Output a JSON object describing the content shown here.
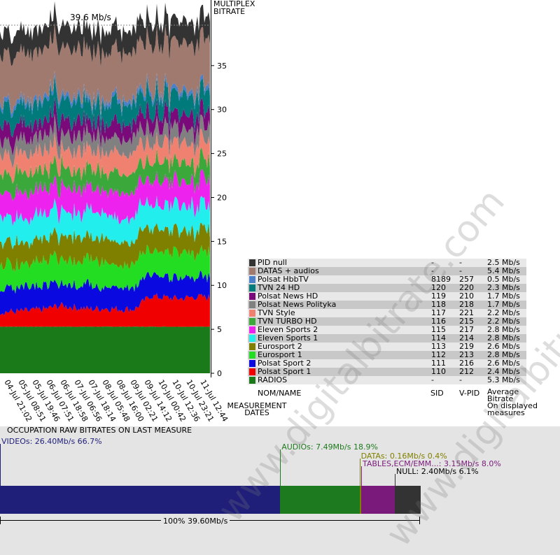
{
  "header": {
    "max_bitrate": "39.6 Mb/s"
  },
  "axis": {
    "title_line1": "MULTIPLEX",
    "title_line2": "BITRATE",
    "measurement_line1": "MEASUREMENT",
    "measurement_line2": "DATES"
  },
  "watermark": "www.digitalbitrate.com",
  "legend_headers": {
    "name": "NOM/NAME",
    "sid": "SID",
    "vpid": "V-PID",
    "avg1": "Average",
    "avg2": "Bitrate",
    "avg3": "On displayed",
    "avg4": "measures"
  },
  "legend": [
    {
      "name": "PID null",
      "sid": "-",
      "vpid": "-",
      "bitrate": "2.5 Mb/s",
      "color": "#333333"
    },
    {
      "name": "DATAS + audios",
      "sid": "-",
      "vpid": "-",
      "bitrate": "5.4 Mb/s",
      "color": "#a07a6e"
    },
    {
      "name": "Polsat  HbbTV",
      "sid": "8189",
      "vpid": "257",
      "bitrate": "0.5 Mb/s",
      "color": "#4a7fc9"
    },
    {
      "name": "TVN 24 HD",
      "sid": "120",
      "vpid": "220",
      "bitrate": "2.3 Mb/s",
      "color": "#007a7a"
    },
    {
      "name": "Polsat News HD",
      "sid": "119",
      "vpid": "210",
      "bitrate": "1.7 Mb/s",
      "color": "#7a0a7a"
    },
    {
      "name": "Polsat News Polityka",
      "sid": "118",
      "vpid": "218",
      "bitrate": "1.7 Mb/s",
      "color": "#808080"
    },
    {
      "name": "TVN Style",
      "sid": "117",
      "vpid": "221",
      "bitrate": "2.2 Mb/s",
      "color": "#f08070"
    },
    {
      "name": "TVN TURBO HD",
      "sid": "116",
      "vpid": "215",
      "bitrate": "2.2 Mb/s",
      "color": "#3aa83a"
    },
    {
      "name": "Eleven Sports 2",
      "sid": "115",
      "vpid": "217",
      "bitrate": "2.8 Mb/s",
      "color": "#ee22ee"
    },
    {
      "name": "Eleven Sports 1",
      "sid": "114",
      "vpid": "214",
      "bitrate": "2.8 Mb/s",
      "color": "#22eeee"
    },
    {
      "name": "Eurosport 2",
      "sid": "113",
      "vpid": "219",
      "bitrate": "2.6 Mb/s",
      "color": "#808000"
    },
    {
      "name": "Eurosport 1",
      "sid": "112",
      "vpid": "213",
      "bitrate": "2.8 Mb/s",
      "color": "#22dd22"
    },
    {
      "name": "Polsat Sport 2",
      "sid": "111",
      "vpid": "216",
      "bitrate": "2.6 Mb/s",
      "color": "#0a0ae0"
    },
    {
      "name": "Polsat Sport 1",
      "sid": "110",
      "vpid": "212",
      "bitrate": "2.4 Mb/s",
      "color": "#f00000"
    },
    {
      "name": "RADIOS",
      "sid": "-",
      "vpid": "-",
      "bitrate": "5.3 Mb/s",
      "color": "#1a7a1a"
    }
  ],
  "occupation": {
    "title": "OCCUPATION RAW BITRATES ON LAST MEASURE",
    "total": "100%  39.60Mb/s",
    "segments": [
      {
        "label": "VIDEOs: 26.40Mb/s  66.7%",
        "fraction": 0.667,
        "color": "#1f1f7a",
        "text_color": "#1f1f7a"
      },
      {
        "label": "AUDIOs: 7.49Mb/s  18.9%",
        "fraction": 0.189,
        "color": "#1e7a1e",
        "text_color": "#1e7a1e"
      },
      {
        "label": "DATAs: 0.16Mb/s  0.4%",
        "fraction": 0.004,
        "color": "#808000",
        "text_color": "#808000"
      },
      {
        "label": "TABLES,ECM/EMM...: 3.15Mb/s  8.0%",
        "fraction": 0.08,
        "color": "#7a1a7a",
        "text_color": "#7a1a7a"
      },
      {
        "label": "NULL: 2.40Mb/s  6.1%",
        "fraction": 0.061,
        "color": "#333333",
        "text_color": "#000000"
      }
    ]
  },
  "chart_data": {
    "type": "area",
    "title": "39.6 Mb/s",
    "ylabel": "MULTIPLEX BITRATE",
    "xlabel": "MEASUREMENT DATES",
    "ylim": [
      0,
      39.6
    ],
    "yticks": [
      0,
      5,
      10,
      15,
      20,
      25,
      30,
      35
    ],
    "x": [
      "04-Jul 21:02",
      "05-Jul 08:51",
      "05-Jul 19:46",
      "06-Jul 07:51",
      "06-Jul 18:58",
      "07-Jul 06:56",
      "07-Jul 18:14",
      "08-Jul 05:48",
      "08-Jul 16:00",
      "09-Jul 02:21",
      "09-Jul 14:12",
      "10-Jul 00:42",
      "10-Jul 12:36",
      "10-Jul 23:21",
      "11-Jul 12:44"
    ],
    "stack_order": [
      "RADIOS",
      "Polsat Sport 1",
      "Polsat Sport 2",
      "Eurosport 1",
      "Eurosport 2",
      "Eleven Sports 1",
      "Eleven Sports 2",
      "TVN TURBO HD",
      "TVN Style",
      "Polsat News Polityka",
      "Polsat News HD",
      "TVN 24 HD",
      "Polsat  HbbTV",
      "DATAS + audios",
      "PID null"
    ],
    "series": [
      {
        "name": "RADIOS",
        "values": [
          5.3,
          5.3,
          5.3,
          5.3,
          5.3,
          5.3,
          5.3,
          5.3,
          5.3,
          5.3,
          5.3,
          5.3,
          5.3,
          5.3,
          5.3
        ]
      },
      {
        "name": "Polsat Sport 1",
        "values": [
          1.7,
          1.7,
          1.8,
          2.0,
          2.4,
          2.2,
          2.0,
          2.1,
          2.0,
          2.0,
          3.5,
          3.3,
          3.2,
          3.4,
          3.3
        ]
      },
      {
        "name": "Polsat Sport 2",
        "values": [
          2.9,
          2.7,
          2.8,
          2.6,
          2.5,
          2.6,
          3.0,
          2.4,
          2.6,
          2.5,
          2.8,
          2.2,
          2.3,
          2.4,
          2.3
        ]
      },
      {
        "name": "Eurosport 1",
        "values": [
          3.0,
          2.6,
          2.7,
          2.8,
          2.9,
          2.7,
          2.8,
          3.0,
          2.6,
          2.9,
          2.8,
          2.6,
          2.9,
          2.7,
          2.8
        ]
      },
      {
        "name": "Eurosport 2",
        "values": [
          2.6,
          2.7,
          2.5,
          2.6,
          2.6,
          2.8,
          2.5,
          2.7,
          2.6,
          2.5,
          2.7,
          2.6,
          2.6,
          2.5,
          2.6
        ]
      },
      {
        "name": "Eleven Sports 1",
        "values": [
          2.8,
          2.9,
          2.7,
          2.9,
          2.8,
          2.6,
          2.9,
          2.8,
          2.7,
          2.9,
          2.6,
          2.8,
          2.8,
          2.9,
          2.7
        ]
      },
      {
        "name": "Eleven Sports 2",
        "values": [
          2.8,
          2.7,
          2.9,
          2.8,
          2.6,
          2.9,
          2.7,
          2.8,
          2.9,
          2.7,
          2.8,
          2.8,
          2.6,
          2.7,
          2.9
        ]
      },
      {
        "name": "TVN TURBO HD",
        "values": [
          2.2,
          2.3,
          2.1,
          2.2,
          2.4,
          2.1,
          2.2,
          2.3,
          2.1,
          2.2,
          2.2,
          2.3,
          2.1,
          2.2,
          2.2
        ]
      },
      {
        "name": "TVN Style",
        "values": [
          2.2,
          2.1,
          2.3,
          2.2,
          2.0,
          2.3,
          2.2,
          2.1,
          2.4,
          2.2,
          2.1,
          2.2,
          2.3,
          2.1,
          2.2
        ]
      },
      {
        "name": "Polsat News Polityka",
        "values": [
          1.7,
          1.6,
          1.8,
          1.7,
          1.7,
          1.6,
          1.8,
          1.7,
          1.6,
          1.7,
          1.8,
          1.7,
          1.6,
          1.7,
          1.7
        ]
      },
      {
        "name": "Polsat News HD",
        "values": [
          1.7,
          1.8,
          1.6,
          1.7,
          1.8,
          1.7,
          1.6,
          1.7,
          1.8,
          1.6,
          1.7,
          1.7,
          1.8,
          1.6,
          1.7
        ]
      },
      {
        "name": "TVN 24 HD",
        "values": [
          2.3,
          2.4,
          2.3,
          2.2,
          2.3,
          2.4,
          2.2,
          2.3,
          2.4,
          2.3,
          2.2,
          2.3,
          2.4,
          2.2,
          2.3
        ]
      },
      {
        "name": "Polsat  HbbTV",
        "values": [
          0.5,
          0.5,
          0.5,
          0.5,
          0.5,
          0.5,
          0.5,
          0.5,
          0.5,
          0.5,
          0.5,
          0.5,
          0.5,
          0.5,
          0.5
        ]
      },
      {
        "name": "DATAS + audios",
        "values": [
          5.4,
          5.4,
          5.4,
          5.4,
          5.4,
          5.4,
          5.4,
          5.4,
          5.4,
          5.4,
          5.4,
          5.4,
          5.4,
          5.4,
          5.4
        ]
      },
      {
        "name": "PID null",
        "values": [
          2.5,
          2.5,
          2.5,
          2.5,
          2.5,
          2.5,
          2.5,
          2.5,
          2.5,
          2.5,
          2.5,
          2.5,
          2.5,
          2.5,
          2.5
        ]
      }
    ],
    "legend_position": "right"
  }
}
